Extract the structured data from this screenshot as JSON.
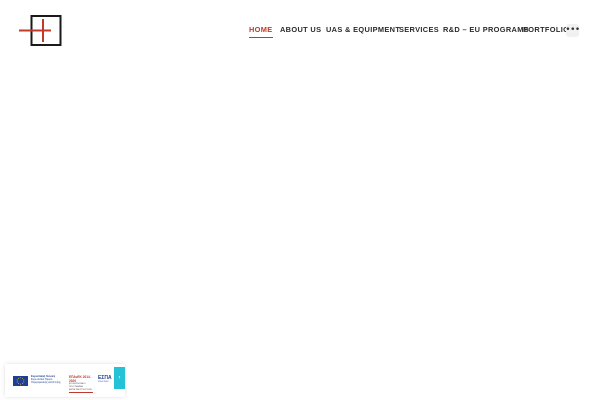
{
  "colors": {
    "accent": "#c0392b",
    "nav_text": "#2b2b2b",
    "eu_blue": "#1f3f95",
    "side_tab": "#23c2d6"
  },
  "logo": {
    "icon": "cross-square-logo"
  },
  "nav": {
    "items": [
      {
        "label": "HOME",
        "active": true
      },
      {
        "label": "ABOUT US",
        "active": false
      },
      {
        "label": "UAS & EQUIPMENT",
        "active": false
      },
      {
        "label": "SERVICES",
        "active": false
      },
      {
        "label": "R&D – EU PROGRAMS",
        "active": false
      },
      {
        "label": "PORTFOLIO",
        "active": false
      }
    ],
    "more_symbol": "•••",
    "more_icon": "more-dots-icon"
  },
  "eu_banner": {
    "eu_line1": "Ευρωπαϊκή Ένωση",
    "eu_line2": "Ευρωπαϊκό Ταμείο",
    "eu_line3": "Περιφερειακής Ανάπτυξης",
    "espa_line1": "ΕΠΑνΕΚ 2014-2020",
    "espa_line2": "ΕΠΙΧΕΙΡΗΣΙΑΚΟ ΠΡΟΓΡΑΜΜΑ",
    "espa_line3": "ΑΝΤΑΓΩΝΙΣΤΙΚΟΤΗΤΑ",
    "espa2_line1": "ΕΣΠΑ",
    "espa2_line2": "2014-2020",
    "toggle_symbol": "›",
    "toggle_icon": "chevron-right-icon"
  }
}
